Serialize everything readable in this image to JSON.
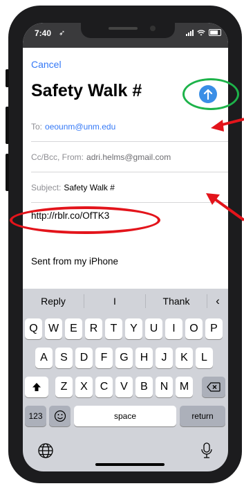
{
  "status_bar": {
    "time": "7:40"
  },
  "compose": {
    "cancel_label": "Cancel",
    "title": "Safety Walk #",
    "send_icon": "arrow-up-icon",
    "to_label": "To:",
    "to_value": "oeounm@unm.edu",
    "ccbcc_label": "Cc/Bcc, From:",
    "from_value": "adri.helms@gmail.com",
    "subject_label": "Subject:",
    "subject_value": "Safety Walk #",
    "body_link": "http://rblr.co/OfTK3",
    "signature": "Sent from my iPhone"
  },
  "keyboard": {
    "suggestions": [
      "Reply",
      "I",
      "Thank"
    ],
    "row1": [
      "Q",
      "W",
      "E",
      "R",
      "T",
      "Y",
      "U",
      "I",
      "O",
      "P"
    ],
    "row2": [
      "A",
      "S",
      "D",
      "F",
      "G",
      "H",
      "J",
      "K",
      "L"
    ],
    "row3": [
      "Z",
      "X",
      "C",
      "V",
      "B",
      "N",
      "M"
    ],
    "numbers_label": "123",
    "space_label": "space",
    "return_label": "return"
  },
  "colors": {
    "accent": "#3478f6",
    "send_button": "#3a8ee6",
    "annotation_green": "#1db34a",
    "annotation_red": "#e3141b"
  }
}
